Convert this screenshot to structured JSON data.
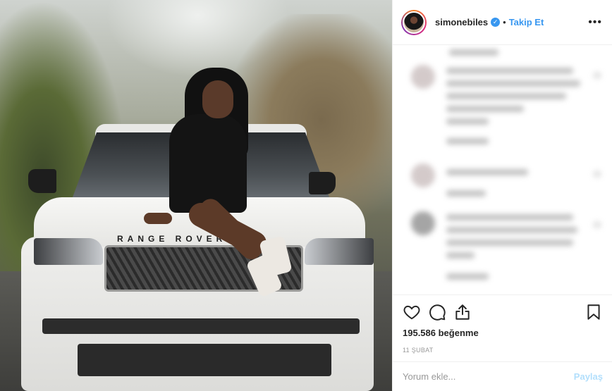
{
  "photo": {
    "description_alt": "",
    "car_badge": "RANGE ROVER"
  },
  "header": {
    "username": "simonebiles",
    "verified_icon": "verified-badge-icon",
    "separator": "•",
    "follow_label": "Takip Et",
    "more_icon": "more-options-icon",
    "more_glyph": "•••"
  },
  "actions": {
    "like_icon": "heart-icon",
    "comment_icon": "comment-icon",
    "share_icon": "share-icon",
    "save_icon": "bookmark-icon",
    "likes_text": "195.586 beğenme",
    "date_text": "11 ŞUBAT"
  },
  "add_comment": {
    "placeholder": "Yorum ekle...",
    "post_label": "Paylaş"
  },
  "colors": {
    "accent": "#3897f0",
    "post_disabled": "#b2dffc"
  }
}
